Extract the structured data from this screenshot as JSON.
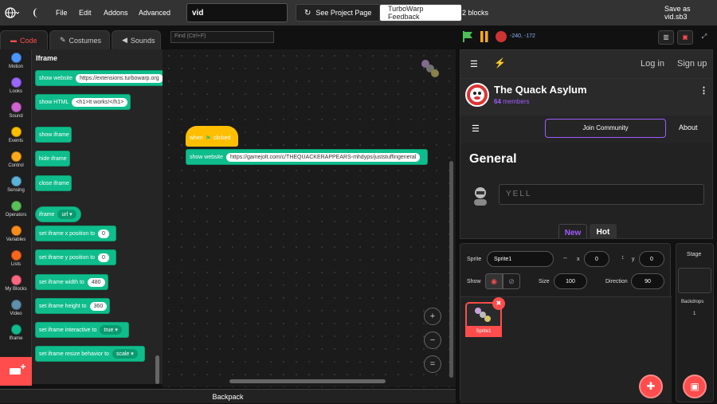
{
  "menubar": {
    "file": "File",
    "edit": "Edit",
    "addons": "Addons",
    "advanced": "Advanced",
    "project_title": "vid",
    "see_project": "See Project Page",
    "feedback": "TurboWarp Feedback",
    "block_count": "2 blocks",
    "save_as": "Save as vid.sb3"
  },
  "tabs": {
    "code": "Code",
    "costumes": "Costumes",
    "sounds": "Sounds"
  },
  "find_placeholder": "Find (Ctrl+F)",
  "categories": [
    "Motion",
    "Looks",
    "Sound",
    "Events",
    "Control",
    "Sensing",
    "Operators",
    "Variables",
    "Lists",
    "My Blocks",
    "Video",
    "Iframe"
  ],
  "category_colors": [
    "#4c97ff",
    "#9966ff",
    "#cf63cf",
    "#ffbf00",
    "#ffab19",
    "#5cb1d6",
    "#59c059",
    "#ff8c1a",
    "#ff661a",
    "#ff6680",
    "#5f8fab",
    "#0fbd8c"
  ],
  "palette": {
    "title": "Iframe",
    "show_website": "show website",
    "show_website_url": "https://extensions.turbowarp.org",
    "show_html": "show HTML",
    "show_html_value": "<h1>It works!</h1>",
    "show_iframe": "show iframe",
    "hide_iframe": "hide iframe",
    "close_iframe": "close iframe",
    "iframe": "iframe",
    "iframe_dd": "url",
    "set_x": "set iframe x position to",
    "set_x_val": "0",
    "set_y": "set iframe y position to",
    "set_y_val": "0",
    "set_w": "set iframe width to",
    "set_w_val": "480",
    "set_h": "set iframe height to",
    "set_h_val": "360",
    "set_interactive": "set iframe interactive to",
    "set_interactive_dd": "true",
    "set_resize": "set iframe resize behavior to",
    "set_resize_dd": "scale"
  },
  "script": {
    "when": "when",
    "clicked": "clicked",
    "show_website": "show website",
    "url": "https://gamejolt.com/c/THEQUACKERAPPEARS-mhdyps/juststuffingeneral"
  },
  "backpack": "Backpack",
  "stage": {
    "coords": "-240, -172",
    "login": "Log in",
    "signup": "Sign up",
    "community_name": "The Quack Asylum",
    "member_count": "64",
    "members_label": "members",
    "join": "Join Community",
    "about": "About",
    "channel": "General",
    "yell_placeholder": "YELL",
    "new": "New",
    "hot": "Hot"
  },
  "sprite": {
    "sprite_label": "Sprite",
    "sprite_name": "Sprite1",
    "x_label": "x",
    "x_val": "0",
    "y_label": "y",
    "y_val": "0",
    "show_label": "Show",
    "size_label": "Size",
    "size_val": "100",
    "direction_label": "Direction",
    "direction_val": "90",
    "thumb_name": "Sprite1"
  },
  "stage_pane": {
    "title": "Stage",
    "backdrops_label": "Backdrops",
    "backdrops_count": "1"
  },
  "colors": {
    "accent": "#ff4c4c",
    "extension": "#0fbd8c",
    "events": "#ffbf00",
    "purple": "#a05cff"
  }
}
